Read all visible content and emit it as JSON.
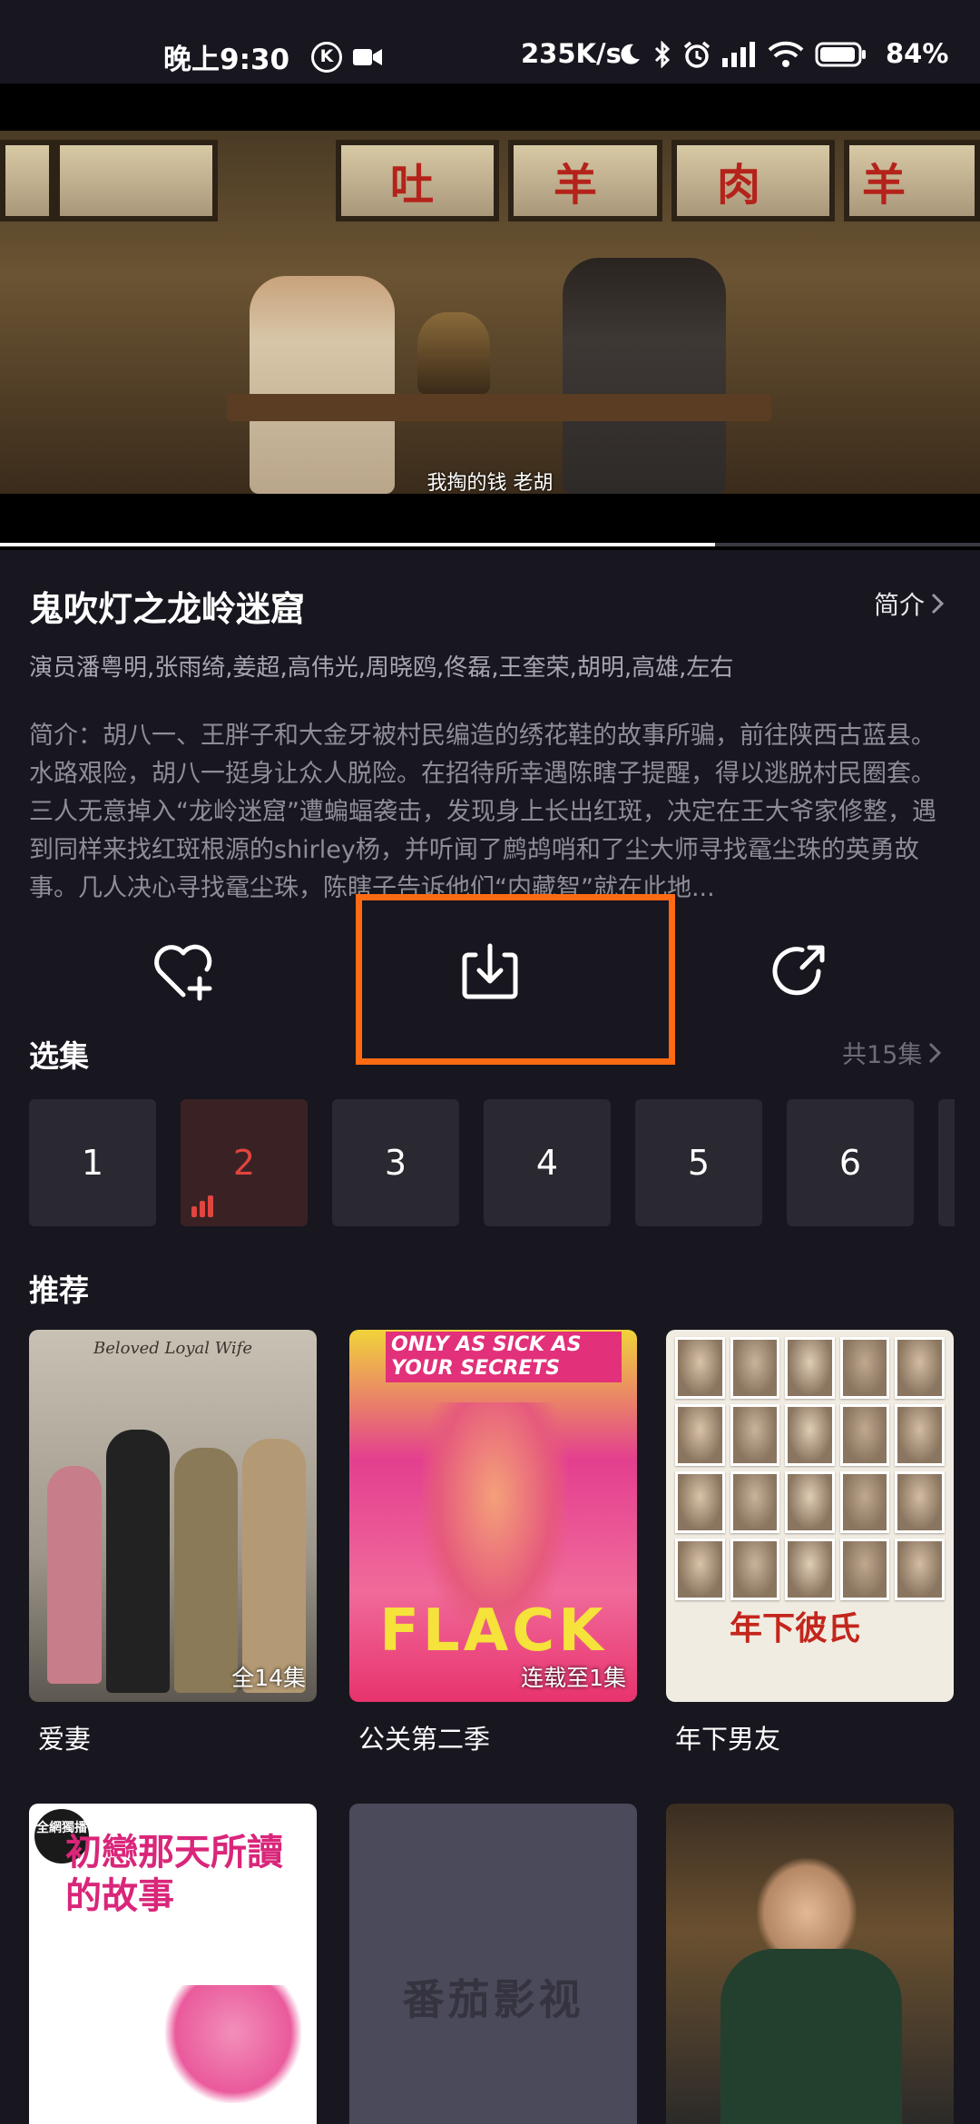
{
  "status_bar": {
    "time": "晚上9:30",
    "network_speed": "235K/s",
    "battery": "84%"
  },
  "player": {
    "subtitle": "我掏的钱  老胡",
    "progress_fraction": 0.73
  },
  "show": {
    "title": "鬼吹灯之龙岭迷窟",
    "intro_label": "简介",
    "cast": "演员潘粤明,张雨绮,姜超,高伟光,周晓鸥,佟磊,王奎荣,胡明,高雄,左右",
    "synopsis": "简介：胡八一、王胖子和大金牙被村民编造的绣花鞋的故事所骗，前往陕西古蓝县。水路艰险，胡八一挺身让众人脱险。在招待所幸遇陈瞎子提醒，得以逃脱村民圈套。三人无意掉入“龙岭迷窟”遭蝙蝠袭击，发现身上长出红斑，决定在王大爷家修整，遇到同样来找红斑根源的shirley杨，并听闻了鹧鸪哨和了尘大师寻找鼋尘珠的英勇故事。几人决心寻找鼋尘珠，陈瞎子告诉他们“内藏智”就在此地..."
  },
  "actions": [
    {
      "icon": "heart-plus-icon"
    },
    {
      "icon": "download-icon"
    },
    {
      "icon": "share-icon"
    }
  ],
  "episodes_section": {
    "title": "选集",
    "total": "共15集",
    "items": [
      "1",
      "2",
      "3",
      "4",
      "5",
      "6"
    ],
    "active_index": 1
  },
  "recommend_section": {
    "title": "推荐",
    "items": [
      {
        "name": "爱妻",
        "badge": "全14集",
        "poster_text": "Beloved Loyal Wife"
      },
      {
        "name": "公关第二季",
        "badge": "连载至1集",
        "poster_text": "FLACK",
        "poster_tagline": "ONLY AS SICK AS YOUR SECRETS"
      },
      {
        "name": "年下男友",
        "badge": "",
        "poster_text": "年下彼氏"
      },
      {
        "name": "",
        "badge": "",
        "poster_text": "初戀那天所讀的故事",
        "corner_badge": "全網獨播"
      },
      {
        "name": "",
        "badge": "",
        "poster_text": "番茄影视"
      },
      {
        "name": "",
        "badge": "",
        "poster_text": ""
      }
    ]
  },
  "colors": {
    "background": "#18161f",
    "accent_orange": "#ff6a13",
    "active_red": "#e0453f"
  }
}
